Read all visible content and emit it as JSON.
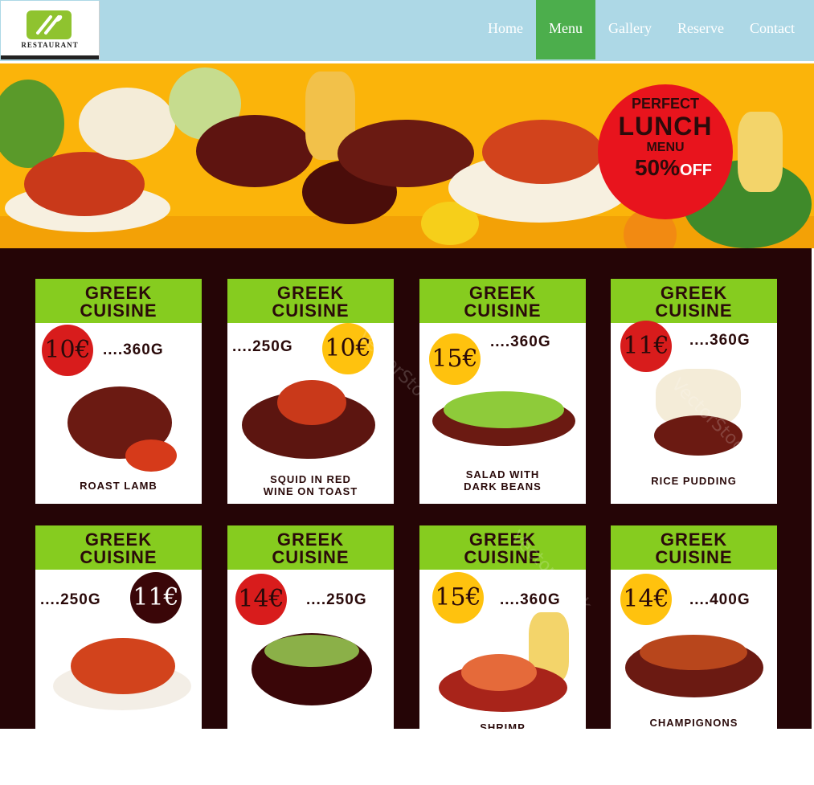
{
  "header": {
    "logo_text": "RESTAURANT",
    "nav": [
      "Home",
      "Menu",
      "Gallery",
      "Reserve",
      "Contact"
    ],
    "active_nav": "Menu"
  },
  "banner": {
    "promo_line1": "PERFECT",
    "promo_line2": "LUNCH",
    "promo_line3": "MENU",
    "promo_discount": "50%",
    "promo_off": "OFF"
  },
  "cards": [
    {
      "head1": "GREEK",
      "head2": "CUISINE",
      "price": "10€",
      "weight": "....360G",
      "name": "ROAST LAMB"
    },
    {
      "head1": "GREEK",
      "head2": "CUISINE",
      "price": "10€",
      "weight": "....250G",
      "name": "SQUID IN RED WINE ON TOAST"
    },
    {
      "head1": "GREEK",
      "head2": "CUISINE",
      "price": "15€",
      "weight": "....360G",
      "name": "SALAD WITH DARK BEANS"
    },
    {
      "head1": "GREEK",
      "head2": "CUISINE",
      "price": "11€",
      "weight": "....360G",
      "name": "RICE PUDDING"
    },
    {
      "head1": "GREEK",
      "head2": "CUISINE",
      "price": "11€",
      "weight": "....250G",
      "name": ""
    },
    {
      "head1": "GREEK",
      "head2": "CUISINE",
      "price": "14€",
      "weight": "....250G",
      "name": ""
    },
    {
      "head1": "GREEK",
      "head2": "CUISINE",
      "price": "15€",
      "weight": "....360G",
      "name": "SHRIMP"
    },
    {
      "head1": "GREEK",
      "head2": "CUISINE",
      "price": "14€",
      "weight": "....400G",
      "name": "CHAMPIGNONS"
    }
  ],
  "watermark": "VectorStock"
}
